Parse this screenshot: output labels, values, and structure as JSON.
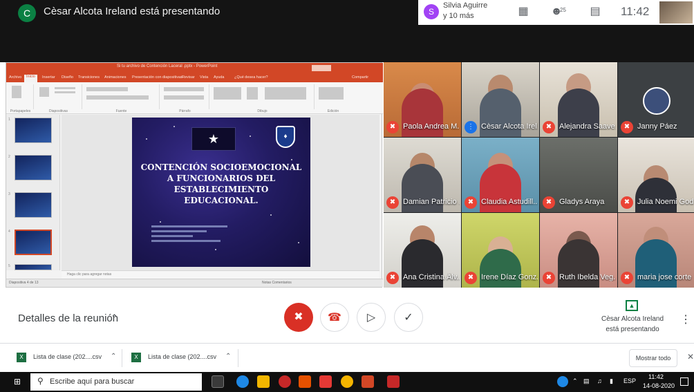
{
  "header": {
    "presenter_initial": "C",
    "presenter_text": "Cèsar Alcota Ireland está presentando",
    "others_initial": "S",
    "others_line1": "Silvia Aguirre",
    "others_line2": "y 10 más",
    "people_count": "25",
    "time": "11:42"
  },
  "ppt": {
    "window_title": "Si tu archivo de Contención Laceral .pptx - PowerPoint",
    "tabs": [
      "Archivo",
      "Inicio",
      "Insertar",
      "Diseño",
      "Transiciones",
      "Animaciones",
      "Presentación con diapositivas",
      "Revisar",
      "Vista",
      "Ayuda",
      "¿Qué desea hacer?"
    ],
    "share": "Compartir",
    "ribbon_groups": [
      "Portapapeles",
      "Diapositivas",
      "Fuente",
      "Párrafo",
      "Dibujo",
      "Edición"
    ],
    "slide_numbers": [
      "1",
      "2",
      "3",
      "4",
      "5"
    ],
    "slide_title": "CONTENCIÓN SOCIOEMOCIONAL A FUNCIONARIOS DEL ESTABLECIMIENTO EDUCACIONAL.",
    "notes_placeholder": "Haga clic para agregar notas",
    "status_left": "Diapositiva 4 de 13",
    "status_right": "Notas   Comentarios"
  },
  "participants": [
    {
      "name": "Paola Andrea M...",
      "muted": true
    },
    {
      "name": "Cèsar Alcota Irel...",
      "muted": false
    },
    {
      "name": "Alejandra Saave...",
      "muted": true
    },
    {
      "name": "Janny Páez",
      "muted": true
    },
    {
      "name": "Damian Patricio ...",
      "muted": true
    },
    {
      "name": "Claudia Astudill...",
      "muted": true
    },
    {
      "name": "Gladys Araya",
      "muted": true
    },
    {
      "name": "Julia Noemi God",
      "muted": true
    },
    {
      "name": "Ana Cristina Álv...",
      "muted": true
    },
    {
      "name": "Irene Díaz Gonz...",
      "muted": true
    },
    {
      "name": "Ruth Ibelda Veg...",
      "muted": true
    },
    {
      "name": "maria jose corte",
      "muted": true
    }
  ],
  "controls": {
    "meeting_details": "Detalles de la reunión",
    "presenting_line1": "Cèsar Alcota Ireland",
    "presenting_line2": "está presentando"
  },
  "downloads": {
    "items": [
      "Lista de clase (202....csv",
      "Lista de clase (202....csv"
    ],
    "show_all": "Mostrar todo"
  },
  "taskbar": {
    "search_placeholder": "Escribe aquí para buscar",
    "lang": "ESP",
    "time": "11:42",
    "date": "14-08-2020"
  }
}
